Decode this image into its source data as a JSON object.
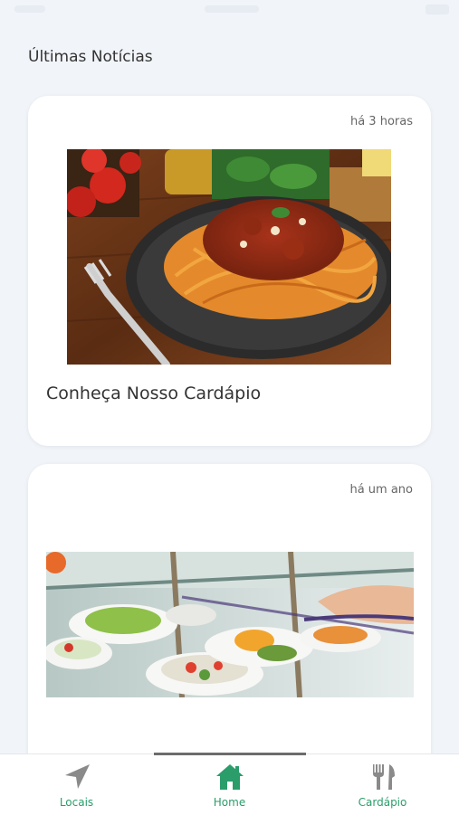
{
  "header": {
    "title": "Últimas Notícias"
  },
  "news": [
    {
      "time": "há 3 horas",
      "title": "Conheça Nosso Cardápio",
      "image": "spaghetti-bolognese-photo"
    },
    {
      "time": "há um ano",
      "title": "",
      "image": "salad-buffet-photo"
    }
  ],
  "tabs": [
    {
      "label": "Locais",
      "icon": "navigation-arrow-icon"
    },
    {
      "label": "Home",
      "icon": "home-icon",
      "active": true
    },
    {
      "label": "Cardápio",
      "icon": "fork-knife-icon"
    }
  ],
  "colors": {
    "accent": "#2a9d6a",
    "inactive_icon": "#888888",
    "background": "#f1f4f9"
  }
}
